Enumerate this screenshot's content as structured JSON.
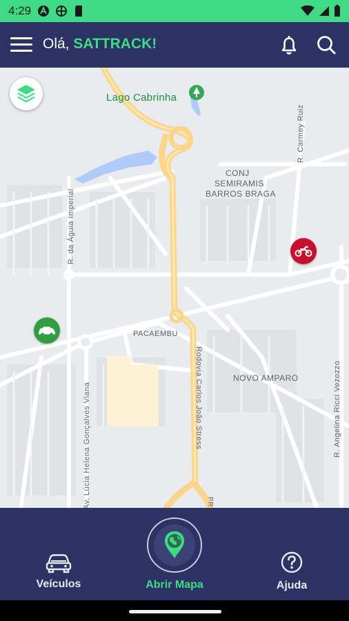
{
  "status_bar": {
    "time": "4:29",
    "background": "#3ddc84"
  },
  "header": {
    "greeting_prefix": "Olá,",
    "user_name": "SATTRACK!",
    "background": "#2c3263",
    "accent": "#3ddc84",
    "icons": [
      "menu-icon",
      "bell-icon",
      "search-icon"
    ]
  },
  "map": {
    "place_labels": {
      "lake": "Lago Cabrinha",
      "conj_line1": "CONJ",
      "conj_line2": "SEMIRAMIS",
      "conj_line3": "BARROS BRAGA",
      "pacaembu": "PACAEMBU",
      "novo_amparo": "NOVO AMPARO"
    },
    "street_labels": {
      "aguia_imperial": "R. da Águia Imperial",
      "carmey_ruiz": "R. Carmey Ruiz",
      "lucia_helena": "Av. Lúcia Helena Gonçalves Viana",
      "rodovia": "Rodovia Carlos João Stress",
      "angelina": "R. Angelina Ricci Vezozzo",
      "pr": "PR"
    },
    "vehicles": [
      {
        "type": "motorcycle",
        "color": "#c8102e"
      },
      {
        "type": "car",
        "color": "#2e9e3e"
      }
    ]
  },
  "bottom_nav": {
    "vehicles_label": "Veículos",
    "open_map_label": "Abrir Mapa",
    "help_label": "Ajuda",
    "active_color": "#3ddc84"
  }
}
